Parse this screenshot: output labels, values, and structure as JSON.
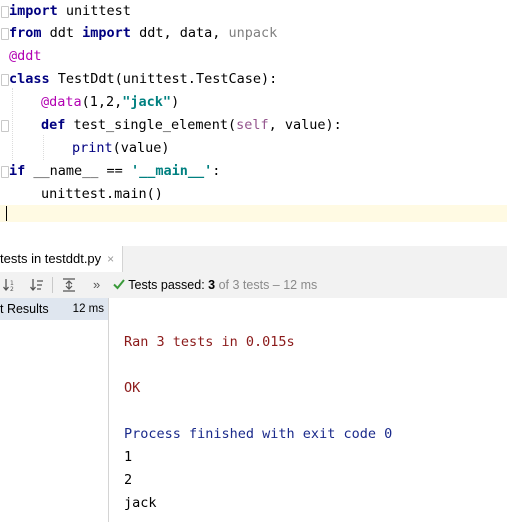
{
  "editor": {
    "lines": {
      "l1": {
        "kw": "import",
        "rest": " unittest"
      },
      "l2": {
        "kw1": "from",
        "mid1": " ddt ",
        "kw2": "import",
        "mid2": " ddt, data, ",
        "unused": "unpack"
      },
      "l3": {
        "deco": "@ddt"
      },
      "l4": {
        "kw": "class",
        "rest": " TestDdt(unittest.TestCase):"
      },
      "l5": {
        "deco": "@data",
        "open": "(1,2,",
        "str": "\"jack\"",
        "close": ")"
      },
      "l6": {
        "kw": "def",
        "name": " test_single_element(",
        "self": "self",
        "rest": ", value):"
      },
      "l7": {
        "builtin": "print",
        "rest": "(value)"
      },
      "l8": {
        "kw": "if",
        "mid": " __name__ == ",
        "str": "'__main__'",
        "rest": ":"
      },
      "l9": {
        "text": "unittest.main()"
      }
    }
  },
  "run_panel": {
    "tab_label": "tests in testddt.py",
    "tab_close": "×",
    "toolbar": {
      "sort_alpha_icon": "↓a",
      "sort_duration_icon": "↓≡",
      "collapse_icon": "⊼",
      "more_icon": "»",
      "status_prefix": "Tests passed:",
      "passed_count": "3",
      "status_suffix": "of 3 tests – 12 ms"
    },
    "tree": {
      "row_label": "t Results",
      "row_time": "12 ms"
    },
    "console": {
      "ran_line": "Ran 3 tests in 0.015s",
      "ok_line": "OK",
      "process_line": "Process finished with exit code 0",
      "out1": "1",
      "out2": "2",
      "out3": "jack"
    }
  },
  "colors": {
    "keyword": "#000080",
    "decorator": "#b200b2",
    "string": "#008080",
    "current_line": "#fffae3",
    "pass_green": "#3a9a3a",
    "stderr_red": "#8b1a1a",
    "system_blue": "#1a2a8b"
  }
}
